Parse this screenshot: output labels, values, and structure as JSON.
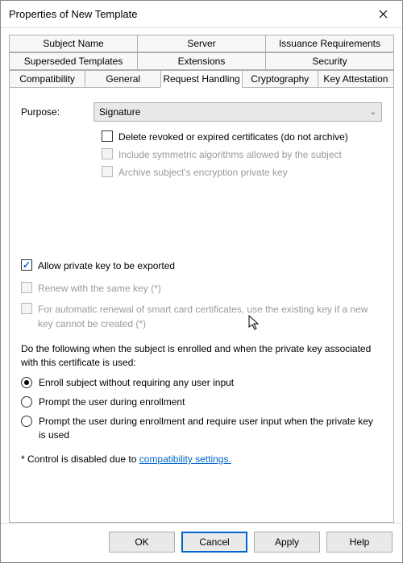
{
  "window": {
    "title": "Properties of New Template"
  },
  "tabs": {
    "row1": [
      "Subject Name",
      "Server",
      "Issuance Requirements"
    ],
    "row2": [
      "Superseded Templates",
      "Extensions",
      "Security"
    ],
    "row3": [
      "Compatibility",
      "General",
      "Request Handling",
      "Cryptography",
      "Key Attestation"
    ]
  },
  "panel": {
    "purpose_label": "Purpose:",
    "purpose_value": "Signature",
    "chk_delete": "Delete revoked or expired certificates (do not archive)",
    "chk_include": "Include symmetric algorithms allowed by the subject",
    "chk_archive": "Archive subject's encryption private key",
    "chk_allow_export": "Allow private key to be exported",
    "chk_renew": "Renew with the same key (*)",
    "chk_autorenew": "For automatic renewal of smart card certificates, use the existing key if a new key cannot be created (*)",
    "enroll_text": "Do the following when the subject is enrolled and when the private key associated with this certificate is used:",
    "radio_enroll": "Enroll subject without requiring any user input",
    "radio_prompt1": "Prompt the user during enrollment",
    "radio_prompt2": "Prompt the user during enrollment and require user input when the private key is used",
    "footnote_prefix": "* Control is disabled due to ",
    "footnote_link": "compatibility settings."
  },
  "buttons": {
    "ok": "OK",
    "cancel": "Cancel",
    "apply": "Apply",
    "help": "Help"
  }
}
